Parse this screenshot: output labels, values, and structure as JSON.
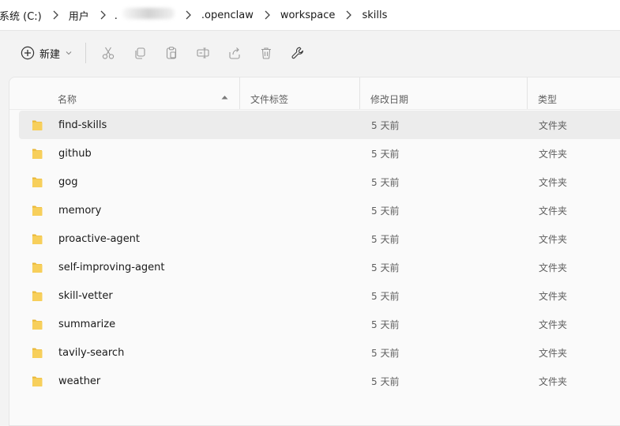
{
  "breadcrumb": {
    "drive": "系统 (C:)",
    "users": "用户",
    "user_dot": ".",
    "openclaw": ".openclaw",
    "workspace": "workspace",
    "skills": "skills"
  },
  "toolbar": {
    "new_label": "新建"
  },
  "columns": {
    "name": "名称",
    "tags": "文件标签",
    "date": "修改日期",
    "type": "类型"
  },
  "files": [
    {
      "name": "find-skills",
      "date": "5 天前",
      "type": "文件夹"
    },
    {
      "name": "github",
      "date": "5 天前",
      "type": "文件夹"
    },
    {
      "name": "gog",
      "date": "5 天前",
      "type": "文件夹"
    },
    {
      "name": "memory",
      "date": "5 天前",
      "type": "文件夹"
    },
    {
      "name": "proactive-agent",
      "date": "5 天前",
      "type": "文件夹"
    },
    {
      "name": "self-improving-agent",
      "date": "5 天前",
      "type": "文件夹"
    },
    {
      "name": "skill-vetter",
      "date": "5 天前",
      "type": "文件夹"
    },
    {
      "name": "summarize",
      "date": "5 天前",
      "type": "文件夹"
    },
    {
      "name": "tavily-search",
      "date": "5 天前",
      "type": "文件夹"
    },
    {
      "name": "weather",
      "date": "5 天前",
      "type": "文件夹"
    }
  ],
  "colors": {
    "folder_fill": "#f7cf5b",
    "folder_tab": "#e9b737",
    "row_hover": "#ececec"
  }
}
